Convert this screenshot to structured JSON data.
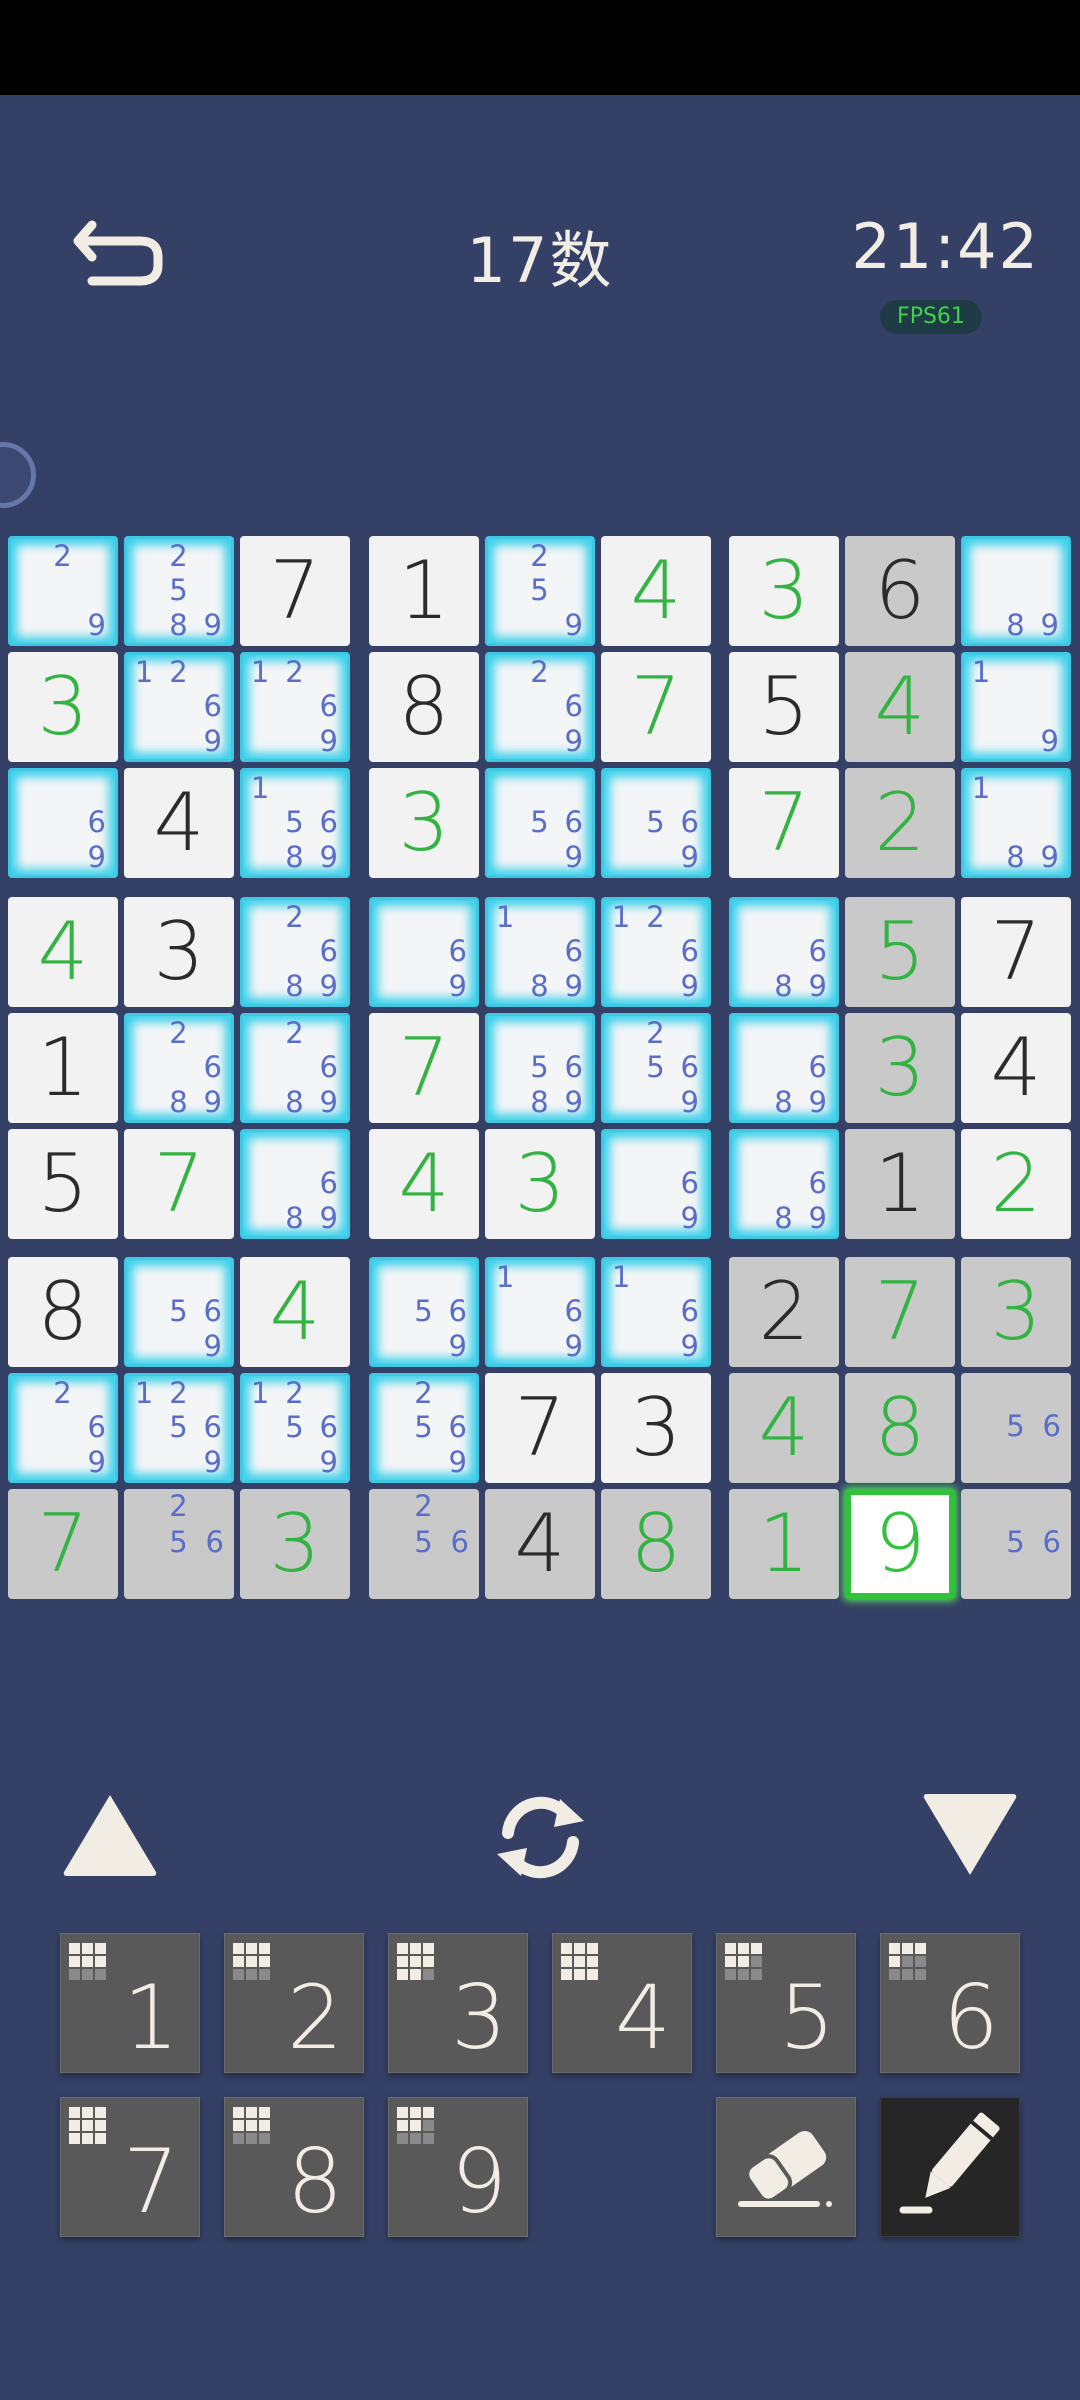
{
  "header": {
    "title": "17数",
    "timer": "21:42",
    "fps": "FPS61"
  },
  "board": [
    [
      {
        "v": "",
        "pm": [
          "2",
          "9"
        ],
        "t": "empty"
      },
      {
        "v": "",
        "pm": [
          "2",
          "5",
          "8",
          "9"
        ],
        "t": "empty"
      },
      {
        "v": "7",
        "t": "given"
      },
      {
        "v": "1",
        "t": "given"
      },
      {
        "v": "",
        "pm": [
          "2",
          "5",
          "9"
        ],
        "t": "empty"
      },
      {
        "v": "4",
        "t": "user"
      },
      {
        "v": "3",
        "t": "user"
      },
      {
        "v": "6",
        "t": "given",
        "grey": true
      },
      {
        "v": "",
        "pm": [
          "8",
          "9"
        ],
        "t": "empty"
      }
    ],
    [
      {
        "v": "3",
        "t": "user"
      },
      {
        "v": "",
        "pm": [
          "1",
          "2",
          "6",
          "9"
        ],
        "t": "empty"
      },
      {
        "v": "",
        "pm": [
          "1",
          "2",
          "6",
          "9"
        ],
        "t": "empty"
      },
      {
        "v": "8",
        "t": "given"
      },
      {
        "v": "",
        "pm": [
          "2",
          "6",
          "9"
        ],
        "t": "empty"
      },
      {
        "v": "7",
        "t": "user"
      },
      {
        "v": "5",
        "t": "given"
      },
      {
        "v": "4",
        "t": "user",
        "grey": true
      },
      {
        "v": "",
        "pm": [
          "1",
          "9"
        ],
        "t": "empty"
      }
    ],
    [
      {
        "v": "",
        "pm": [
          "6",
          "9"
        ],
        "t": "empty"
      },
      {
        "v": "4",
        "t": "given"
      },
      {
        "v": "",
        "pm": [
          "1",
          "5",
          "6",
          "8",
          "9"
        ],
        "t": "empty"
      },
      {
        "v": "3",
        "t": "user"
      },
      {
        "v": "",
        "pm": [
          "5",
          "6",
          "9"
        ],
        "t": "empty"
      },
      {
        "v": "",
        "pm": [
          "5",
          "6",
          "9"
        ],
        "t": "empty"
      },
      {
        "v": "7",
        "t": "user"
      },
      {
        "v": "2",
        "t": "user",
        "grey": true
      },
      {
        "v": "",
        "pm": [
          "1",
          "8",
          "9"
        ],
        "t": "empty"
      }
    ],
    [
      {
        "v": "4",
        "t": "user"
      },
      {
        "v": "3",
        "t": "given"
      },
      {
        "v": "",
        "pm": [
          "2",
          "6",
          "8",
          "9"
        ],
        "t": "empty"
      },
      {
        "v": "",
        "pm": [
          "6",
          "9"
        ],
        "t": "empty"
      },
      {
        "v": "",
        "pm": [
          "1",
          "6",
          "8",
          "9"
        ],
        "t": "empty"
      },
      {
        "v": "",
        "pm": [
          "1",
          "2",
          "6",
          "9"
        ],
        "t": "empty"
      },
      {
        "v": "",
        "pm": [
          "6",
          "8",
          "9"
        ],
        "t": "empty"
      },
      {
        "v": "5",
        "t": "user",
        "grey": true
      },
      {
        "v": "7",
        "t": "given"
      }
    ],
    [
      {
        "v": "1",
        "t": "given"
      },
      {
        "v": "",
        "pm": [
          "2",
          "6",
          "8",
          "9"
        ],
        "t": "empty"
      },
      {
        "v": "",
        "pm": [
          "2",
          "6",
          "8",
          "9"
        ],
        "t": "empty"
      },
      {
        "v": "7",
        "t": "user"
      },
      {
        "v": "",
        "pm": [
          "5",
          "6",
          "8",
          "9"
        ],
        "t": "empty"
      },
      {
        "v": "",
        "pm": [
          "2",
          "5",
          "6",
          "9"
        ],
        "t": "empty"
      },
      {
        "v": "",
        "pm": [
          "6",
          "8",
          "9"
        ],
        "t": "empty"
      },
      {
        "v": "3",
        "t": "user",
        "grey": true
      },
      {
        "v": "4",
        "t": "given"
      }
    ],
    [
      {
        "v": "5",
        "t": "given"
      },
      {
        "v": "7",
        "t": "user"
      },
      {
        "v": "",
        "pm": [
          "6",
          "8",
          "9"
        ],
        "t": "empty"
      },
      {
        "v": "4",
        "t": "user"
      },
      {
        "v": "3",
        "t": "user"
      },
      {
        "v": "",
        "pm": [
          "6",
          "9"
        ],
        "t": "empty"
      },
      {
        "v": "",
        "pm": [
          "6",
          "8",
          "9"
        ],
        "t": "empty"
      },
      {
        "v": "1",
        "t": "given",
        "grey": true
      },
      {
        "v": "2",
        "t": "user"
      }
    ],
    [
      {
        "v": "8",
        "t": "given"
      },
      {
        "v": "",
        "pm": [
          "5",
          "6",
          "9"
        ],
        "t": "empty"
      },
      {
        "v": "4",
        "t": "user"
      },
      {
        "v": "",
        "pm": [
          "5",
          "6",
          "9"
        ],
        "t": "empty"
      },
      {
        "v": "",
        "pm": [
          "1",
          "6",
          "9"
        ],
        "t": "empty"
      },
      {
        "v": "",
        "pm": [
          "1",
          "6",
          "9"
        ],
        "t": "empty"
      },
      {
        "v": "2",
        "t": "given",
        "grey": true
      },
      {
        "v": "7",
        "t": "user",
        "grey": true
      },
      {
        "v": "3",
        "t": "user",
        "grey": true
      }
    ],
    [
      {
        "v": "",
        "pm": [
          "2",
          "6",
          "9"
        ],
        "t": "empty"
      },
      {
        "v": "",
        "pm": [
          "1",
          "2",
          "5",
          "6",
          "9"
        ],
        "t": "empty"
      },
      {
        "v": "",
        "pm": [
          "1",
          "2",
          "5",
          "6",
          "9"
        ],
        "t": "empty"
      },
      {
        "v": "",
        "pm": [
          "2",
          "5",
          "6",
          "9"
        ],
        "t": "empty"
      },
      {
        "v": "7",
        "t": "given"
      },
      {
        "v": "3",
        "t": "given"
      },
      {
        "v": "4",
        "t": "user",
        "grey": true
      },
      {
        "v": "8",
        "t": "user",
        "grey": true
      },
      {
        "v": "",
        "pm": [
          "5",
          "6"
        ],
        "t": "grey"
      }
    ],
    [
      {
        "v": "7",
        "t": "user",
        "grey": true
      },
      {
        "v": "",
        "pm": [
          "2",
          "5",
          "6"
        ],
        "t": "grey"
      },
      {
        "v": "3",
        "t": "user",
        "grey": true
      },
      {
        "v": "",
        "pm": [
          "2",
          "5",
          "6"
        ],
        "t": "grey"
      },
      {
        "v": "4",
        "t": "given",
        "grey": true
      },
      {
        "v": "8",
        "t": "user",
        "grey": true
      },
      {
        "v": "1",
        "t": "user",
        "grey": true
      },
      {
        "v": "9",
        "t": "user",
        "sel": true
      },
      {
        "v": "",
        "pm": [
          "5",
          "6"
        ],
        "t": "grey"
      }
    ]
  ],
  "keypad": {
    "digits": [
      {
        "label": "1",
        "remaining": 3
      },
      {
        "label": "2",
        "remaining": 3
      },
      {
        "label": "3",
        "remaining": 1
      },
      {
        "label": "4",
        "remaining": 0
      },
      {
        "label": "5",
        "remaining": 4
      },
      {
        "label": "6",
        "remaining": 5
      },
      {
        "label": "7",
        "remaining": 0
      },
      {
        "label": "8",
        "remaining": 3
      },
      {
        "label": "9",
        "remaining": 4
      }
    ],
    "erase_icon": "eraser-icon",
    "pencil_icon": "pencil-icon"
  },
  "controls": {
    "up_icon": "triangle-up-icon",
    "down_icon": "triangle-down-icon",
    "rotate_icon": "rotate-icon",
    "back_icon": "back-arrow-icon"
  },
  "colors": {
    "background": "#354066",
    "highlight": "#3fc8e4",
    "user_digit": "#33b342",
    "given_digit": "#2b2b2b",
    "pencil_mark": "#5a6ec8",
    "key": "#595959"
  }
}
